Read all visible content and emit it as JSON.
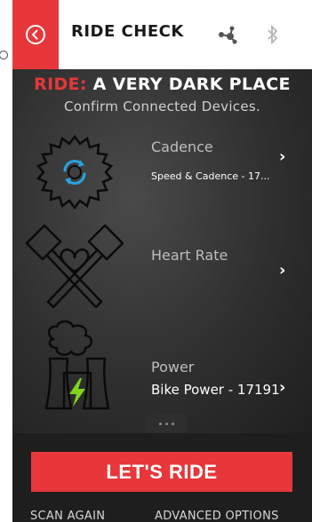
{
  "header": {
    "title": "RIDE CHECK",
    "back_icon": "back-arrow-circle-icon",
    "sensor_icon": "sensor-nodes-icon",
    "bluetooth_icon": "bluetooth-icon"
  },
  "hero": {
    "heading_accent": "RIDE:",
    "heading_main": "A VERY DARK PLACE",
    "subheading": "Confirm Connected Devices."
  },
  "devices": [
    {
      "name": "Cadence",
      "detail": "Speed & Cadence - 17...",
      "icon": "saw-blade-sync-icon"
    },
    {
      "name": "Heart Rate",
      "detail": "",
      "icon": "crossed-hammers-heart-icon"
    },
    {
      "name": "Power",
      "detail": "Bike Power - 17191",
      "icon": "power-plant-bolt-icon"
    }
  ],
  "actions": {
    "primary": "LET'S RIDE",
    "scan": "SCAN AGAIN",
    "advanced": "ADVANCED OPTIONS"
  },
  "colors": {
    "accent": "#e7373b",
    "sync_blue": "#2aa3e0",
    "bolt_green": "#7ed321"
  }
}
